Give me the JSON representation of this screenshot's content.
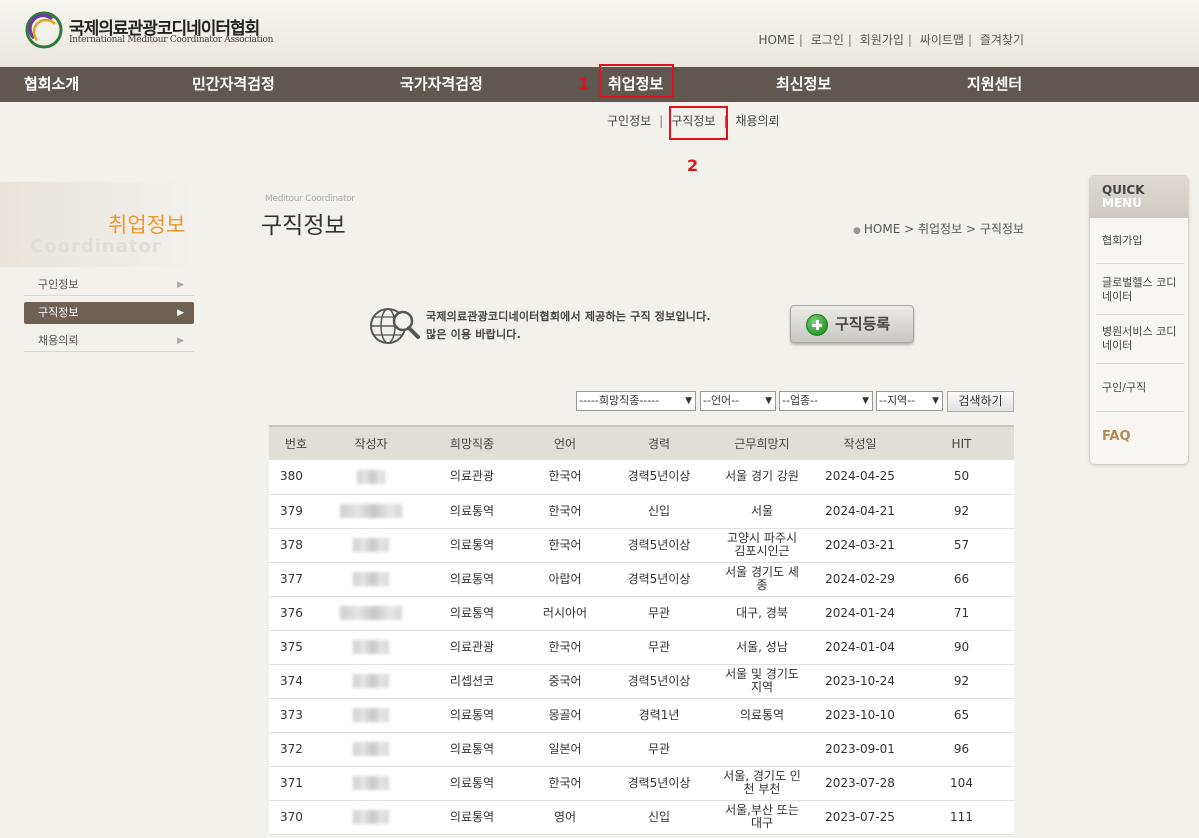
{
  "header": {
    "logo_ko": "국제의료관광코디네이터협회",
    "logo_en": "International Meditour Coordinator Association",
    "util_nav": [
      "HOME",
      "로그인",
      "회원가입",
      "싸이트맵",
      "즐겨찾기"
    ]
  },
  "gnb": {
    "items": [
      "협회소개",
      "민간자격검정",
      "국가자격검정",
      "취업정보",
      "최신정보",
      "지원센터"
    ]
  },
  "annotations": [
    "1",
    "2"
  ],
  "subnav": [
    "구인정보",
    "구직정보",
    "채용의뢰"
  ],
  "sidebar": {
    "title": "취업정보",
    "bg_text": "Coordinator",
    "items": [
      "구인정보",
      "구직정보",
      "채용의뢰"
    ]
  },
  "content": {
    "eng_title": "Meditour Coordinator",
    "title": "구직정보",
    "breadcrumb": [
      "HOME",
      "취업정보",
      "구직정보"
    ],
    "intro_line1": "국제의료관광코디네이터협회에서 제공하는 구직 정보입니다.",
    "intro_line2": "많은 이용 바랍니다.",
    "register_button": "구직등록"
  },
  "search": {
    "job_select": "-----희망직종-----",
    "lang_select": "--언어--",
    "industry_select": "--업종--",
    "region_select": "--지역--",
    "button": "검색하기"
  },
  "table": {
    "headers": [
      "번호",
      "작성자",
      "희망직종",
      "언어",
      "경력",
      "근무희망지",
      "작성일",
      "HIT"
    ],
    "rows": [
      {
        "no": "380",
        "job": "의료관광",
        "lang": "한국어",
        "career": "경력5년이상",
        "place": "서울 경기 강원",
        "date": "2024-04-25",
        "hit": "50"
      },
      {
        "no": "379",
        "job": "의료통역",
        "lang": "한국어",
        "career": "신입",
        "place": "서울",
        "date": "2024-04-21",
        "hit": "92"
      },
      {
        "no": "378",
        "job": "의료통역",
        "lang": "한국어",
        "career": "경력5년이상",
        "place": "고양시 파주시 김포시인근",
        "date": "2024-03-21",
        "hit": "57"
      },
      {
        "no": "377",
        "job": "의료통역",
        "lang": "아랍어",
        "career": "경력5년이상",
        "place": "서울 경기도 세종",
        "date": "2024-02-29",
        "hit": "66"
      },
      {
        "no": "376",
        "job": "의료통역",
        "lang": "러시아어",
        "career": "무관",
        "place": "대구, 경북",
        "date": "2024-01-24",
        "hit": "71"
      },
      {
        "no": "375",
        "job": "의료관광",
        "lang": "한국어",
        "career": "무관",
        "place": "서울, 성남",
        "date": "2024-01-04",
        "hit": "90"
      },
      {
        "no": "374",
        "job": "리셉션코",
        "lang": "중국어",
        "career": "경력5년이상",
        "place": "서울 및 경기도 지역",
        "date": "2023-10-24",
        "hit": "92"
      },
      {
        "no": "373",
        "job": "의료통역",
        "lang": "몽골어",
        "career": "경력1년",
        "place": "의료통역",
        "date": "2023-10-10",
        "hit": "65"
      },
      {
        "no": "372",
        "job": "의료통역",
        "lang": "일본어",
        "career": "무관",
        "place": "",
        "date": "2023-09-01",
        "hit": "96"
      },
      {
        "no": "371",
        "job": "의료통역",
        "lang": "한국어",
        "career": "경력5년이상",
        "place": "서울, 경기도 인천 부천",
        "date": "2023-07-28",
        "hit": "104"
      },
      {
        "no": "370",
        "job": "의료통역",
        "lang": "영어",
        "career": "신입",
        "place": "서울,부산 또는 대구",
        "date": "2023-07-25",
        "hit": "111"
      }
    ]
  },
  "quick_menu": {
    "title1": "QUICK",
    "title2": "MENU",
    "items": [
      "협회가입",
      "글로벌헬스 코디네이터",
      "병원서비스 코디네이터",
      "구인/구직"
    ],
    "faq": "FAQ"
  },
  "colors": {
    "gnb_bg": "#5f5750",
    "accent_orange": "#e89a32",
    "annotation_red": "#e0121b",
    "sidebar_active": "#6e6055"
  }
}
